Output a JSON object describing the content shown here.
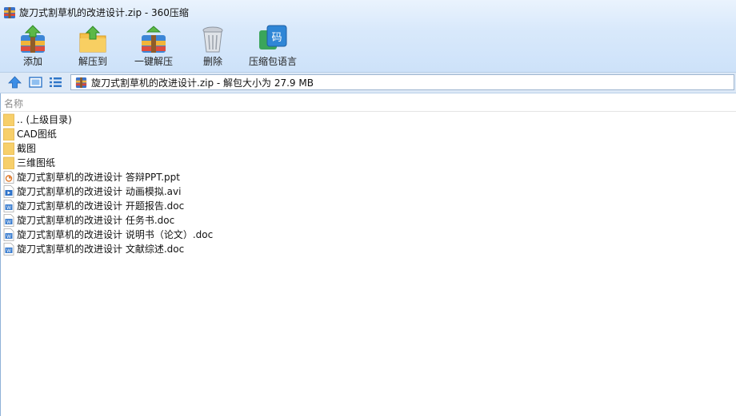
{
  "window": {
    "title": "旋刀式割草机的改进设计.zip - 360压缩"
  },
  "toolbar": {
    "add_label": "添加",
    "extract_to_label": "解压到",
    "one_click_extract_label": "一键解压",
    "delete_label": "删除",
    "language_label": "压缩包语言"
  },
  "address_bar": {
    "path_text": "旋刀式割草机的改进设计.zip - 解包大小为 27.9 MB"
  },
  "list": {
    "name_column": "名称",
    "items": [
      {
        "name": ".. (上级目录)",
        "icon": "folder-icon"
      },
      {
        "name": "CAD图纸",
        "icon": "folder-icon"
      },
      {
        "name": "截图",
        "icon": "folder-icon"
      },
      {
        "name": "三维图纸",
        "icon": "folder-icon"
      },
      {
        "name": "旋刀式割草机的改进设计 答辩PPT.ppt",
        "icon": "ppt-file-icon"
      },
      {
        "name": "旋刀式割草机的改进设计 动画模拟.avi",
        "icon": "video-file-icon"
      },
      {
        "name": "旋刀式割草机的改进设计 开题报告.doc",
        "icon": "doc-file-icon"
      },
      {
        "name": "旋刀式割草机的改进设计 任务书.doc",
        "icon": "doc-file-icon"
      },
      {
        "name": "旋刀式割草机的改进设计 说明书（论文）.doc",
        "icon": "doc-file-icon"
      },
      {
        "name": "旋刀式割草机的改进设计 文献综述.doc",
        "icon": "doc-file-icon"
      }
    ]
  },
  "colors": {
    "chrome_top": "#eaf3fd",
    "chrome_bottom": "#cde2f9",
    "folder": "#f7cf6a",
    "doc_blue": "#3d7fd0",
    "ppt_orange": "#e07b2e"
  }
}
